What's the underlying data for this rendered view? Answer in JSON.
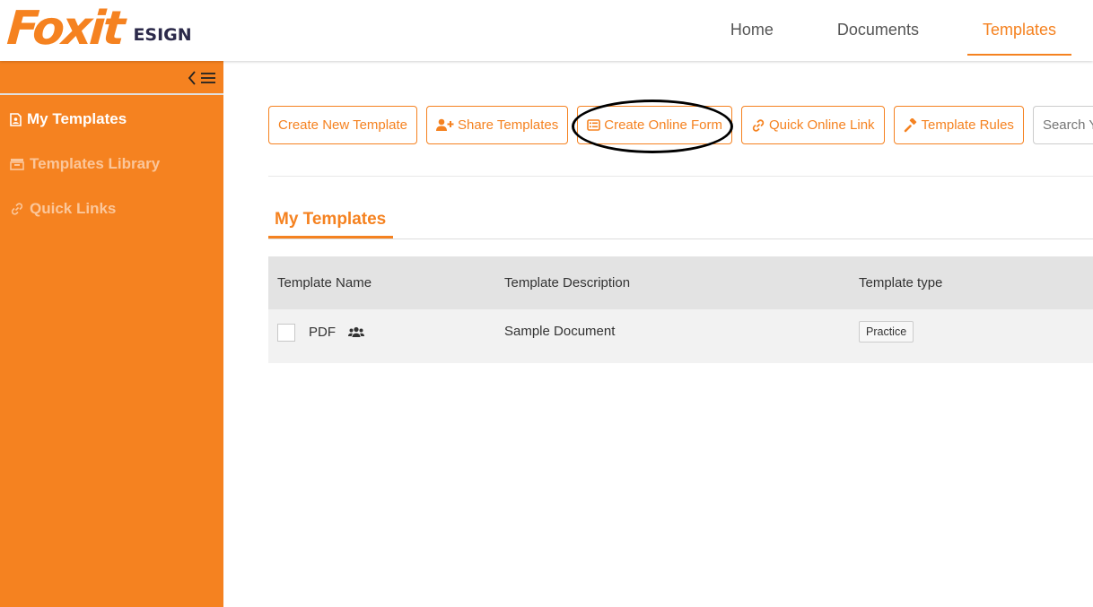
{
  "header": {
    "logo_brand": "Foxit",
    "logo_product": "ESIGN",
    "nav": [
      {
        "label": "Home",
        "active": false
      },
      {
        "label": "Documents",
        "active": false
      },
      {
        "label": "Templates",
        "active": true
      }
    ]
  },
  "sidebar": {
    "collapse_icon": "collapse-menu-icon",
    "items": [
      {
        "label": "My Templates",
        "icon": "template-file-icon",
        "active": true
      },
      {
        "label": "Templates Library",
        "icon": "library-icon",
        "active": false
      },
      {
        "label": "Quick Links",
        "icon": "link-icon",
        "active": false
      }
    ]
  },
  "toolbar": {
    "buttons": [
      {
        "label": "Create New Template",
        "icon": ""
      },
      {
        "label": "Share Templates",
        "icon": "user-plus-icon"
      },
      {
        "label": "Create Online Form",
        "icon": "form-list-icon"
      },
      {
        "label": "Quick Online Link",
        "icon": "link-icon"
      },
      {
        "label": "Template Rules",
        "icon": "gavel-icon"
      }
    ],
    "search_placeholder": "Search Yo"
  },
  "section": {
    "title": "My Templates"
  },
  "table": {
    "columns": [
      "Template Name",
      "Template Description",
      "Template type"
    ],
    "rows": [
      {
        "name": "PDF",
        "shared_icon": "users-icon",
        "description": "Sample Document",
        "type": "Practice"
      }
    ]
  },
  "colors": {
    "accent": "#f58220",
    "logo_text": "#2c2a4a",
    "header_bg": "#ffffff",
    "table_header_bg": "#e3e3e3",
    "table_row_bg": "#f2f2f2"
  },
  "annotation": {
    "shape": "ellipse",
    "color": "#000000",
    "target": "Create Online Form"
  }
}
